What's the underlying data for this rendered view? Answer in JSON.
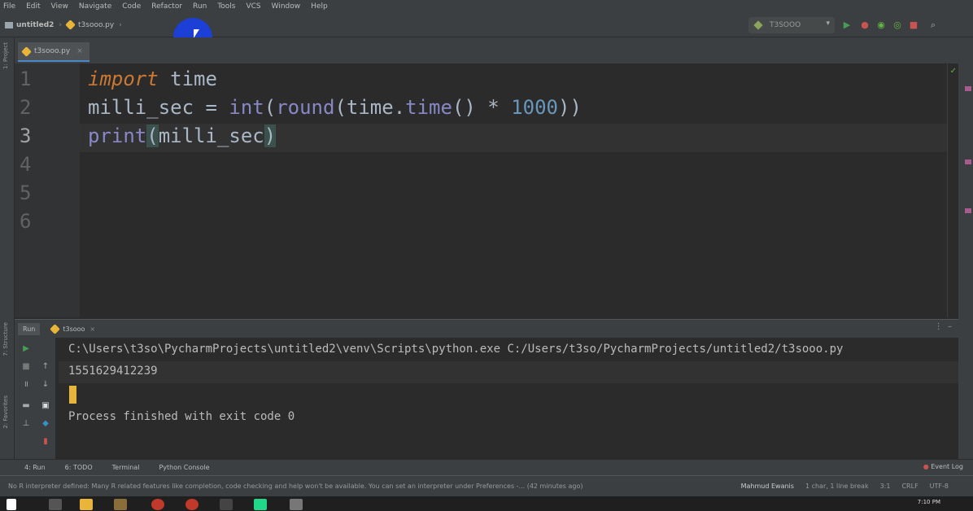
{
  "menu": [
    "File",
    "Edit",
    "View",
    "Navigate",
    "Code",
    "Refactor",
    "Run",
    "Tools",
    "VCS",
    "Window",
    "Help"
  ],
  "breadcrumb": {
    "project": "untitled2",
    "file": "t3sooo.py"
  },
  "run_config": {
    "name": "T3SOOO"
  },
  "left_strip": {
    "project_label": "1: Project",
    "structure_label": "7: Structure",
    "favorites_label": "2: Favorites"
  },
  "editor": {
    "tab_label": "t3sooo.py",
    "line_numbers": [
      "1",
      "2",
      "3",
      "4",
      "5",
      "6"
    ],
    "code": {
      "l1_kw": "import",
      "l1_rest": " time",
      "l2_var": "milli_sec = ",
      "l2_int": "int",
      "l2_p1": "(",
      "l2_round": "round",
      "l2_p2": "(time.",
      "l2_time": "time",
      "l2_p3": "() * ",
      "l2_num": "1000",
      "l2_p4": "))",
      "l3_print": "print",
      "l3_open": "(",
      "l3_arg": "milli_sec",
      "l3_close": ")"
    }
  },
  "run_panel": {
    "label": "Run",
    "tab_label": "t3sooo",
    "console_lines": [
      "C:\\Users\\t3so\\PycharmProjects\\untitled2\\venv\\Scripts\\python.exe C:/Users/t3so/PycharmProjects/untitled2/t3sooo.py",
      "1551629412239",
      "Process finished with exit code 0"
    ]
  },
  "bottom_tabs": {
    "run": "4: Run",
    "todo": "6: TODO",
    "terminal": "Terminal",
    "python_console": "Python Console",
    "event_log": "Event Log"
  },
  "status_bar": {
    "message": "No R interpreter defined: Many R related features like completion, code checking and help won't be available. You can set an interpreter under Preferences -... (42 minutes ago)",
    "user": "Mahmud Ewanis",
    "selection": "1 char, 1 line break",
    "position": "3:1",
    "line_sep": "CRLF",
    "encoding": "UTF-8"
  },
  "taskbar": {
    "time": "7:10 PM"
  },
  "colors": {
    "keyword": "#cc7832",
    "builtin": "#8888c6",
    "number": "#6897bb",
    "text": "#a9b7c6",
    "caret": "#e8b53a",
    "cursor_highlight": "#1c3fd6"
  }
}
